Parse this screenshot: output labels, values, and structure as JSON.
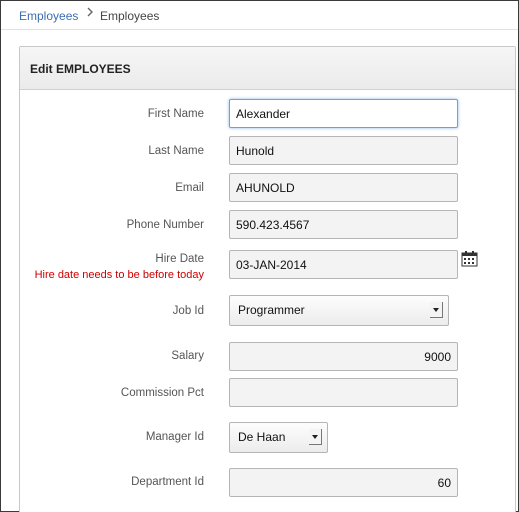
{
  "breadcrumb": {
    "parent": "Employees",
    "current": "Employees"
  },
  "region": {
    "title": "Edit EMPLOYEES"
  },
  "form": {
    "first_name": {
      "label": "First Name",
      "value": "Alexander"
    },
    "last_name": {
      "label": "Last Name",
      "value": "Hunold"
    },
    "email": {
      "label": "Email",
      "value": "AHUNOLD"
    },
    "phone_number": {
      "label": "Phone Number",
      "value": "590.423.4567"
    },
    "hire_date": {
      "label": "Hire Date",
      "value": "03-JAN-2014",
      "error": "Hire date needs to be before today"
    },
    "job_id": {
      "label": "Job Id",
      "value": "Programmer"
    },
    "salary": {
      "label": "Salary",
      "value": "9000"
    },
    "commission_pct": {
      "label": "Commission Pct",
      "value": ""
    },
    "manager_id": {
      "label": "Manager Id",
      "value": "De Haan"
    },
    "department_id": {
      "label": "Department Id",
      "value": "60"
    }
  },
  "icons": {
    "breadcrumb_separator": "chevron-right-icon",
    "date_picker": "calendar-icon",
    "select_arrow": "dropdown-arrow-icon"
  },
  "colors": {
    "link": "#3b6eb4",
    "error": "#cc0000",
    "focus_border": "#6fa0d8"
  }
}
